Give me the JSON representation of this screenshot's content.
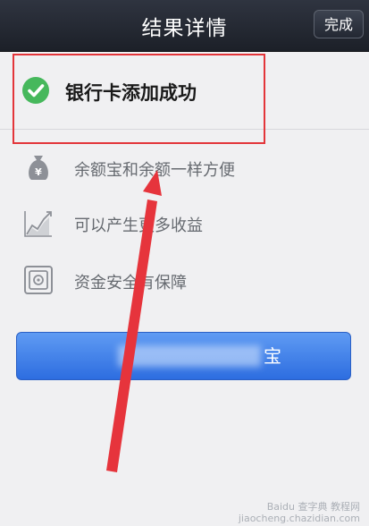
{
  "nav": {
    "title": "结果详情",
    "done_label": "完成"
  },
  "result": {
    "message": "银行卡添加成功",
    "icon": "check-circle-icon"
  },
  "features": [
    {
      "icon": "yen-bag-icon",
      "label": "余额宝和余额一样方便"
    },
    {
      "icon": "growth-chart-icon",
      "label": "可以产生更多收益"
    },
    {
      "icon": "safe-icon",
      "label": "资金安全有保障"
    }
  ],
  "action": {
    "visible_label_tail": "宝"
  },
  "watermark": {
    "line1": "Baidu 查字典 教程网",
    "line2": "jiaocheng.chazidian.com"
  },
  "colors": {
    "nav_bg": "#262b34",
    "success": "#46b85c",
    "annotation_red": "#e3353a",
    "button_blue": "#3d7ee8"
  }
}
